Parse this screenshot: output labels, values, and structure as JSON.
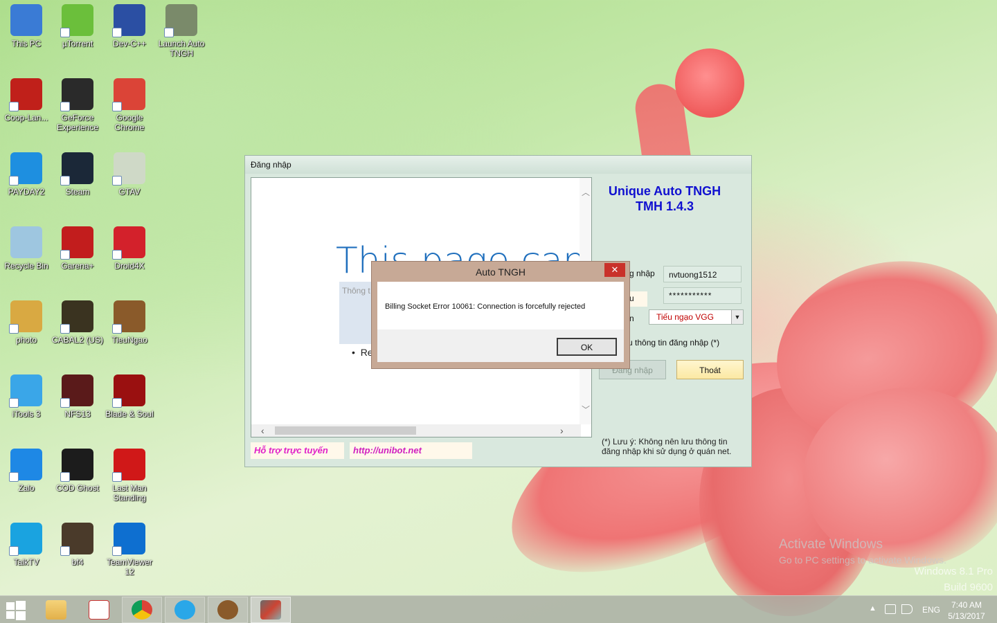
{
  "desktop": {
    "icons": [
      {
        "label": "This PC",
        "icon": "computer-icon"
      },
      {
        "label": "µTorrent",
        "icon": "utorrent-icon"
      },
      {
        "label": "Dev-C++",
        "icon": "devcpp-icon"
      },
      {
        "label": "Launch Auto TNGH",
        "icon": "launch-auto-icon"
      },
      {
        "label": "Coop-Lan...",
        "icon": "cooplan-icon"
      },
      {
        "label": "GeForce Experience",
        "icon": "geforce-icon"
      },
      {
        "label": "Google Chrome",
        "icon": "chrome-icon"
      },
      {
        "label": "PAYDAY2",
        "icon": "payday-icon"
      },
      {
        "label": "Steam",
        "icon": "steam-icon"
      },
      {
        "label": "GTAV",
        "icon": "gtav-icon"
      },
      {
        "label": "Recycle Bin",
        "icon": "recycle-bin-icon"
      },
      {
        "label": "Garena+",
        "icon": "garena-icon"
      },
      {
        "label": "Droid4X",
        "icon": "droid4x-icon"
      },
      {
        "label": "photo",
        "icon": "folder-icon"
      },
      {
        "label": "CABAL2 (US)",
        "icon": "cabal-icon"
      },
      {
        "label": "TieuNgao",
        "icon": "tieungao-icon"
      },
      {
        "label": "iTools 3",
        "icon": "itools-icon"
      },
      {
        "label": "NFS13",
        "icon": "nfs-icon"
      },
      {
        "label": "Blade & Soul",
        "icon": "blade-soul-icon"
      },
      {
        "label": "Zalo",
        "icon": "zalo-icon"
      },
      {
        "label": "COD Ghost",
        "icon": "cod-icon"
      },
      {
        "label": "Last Man Standing",
        "icon": "lastman-icon"
      },
      {
        "label": "TalkTV",
        "icon": "talktv-icon"
      },
      {
        "label": "bf4",
        "icon": "bf4-icon"
      },
      {
        "label": "TeamViewer 12",
        "icon": "teamviewer-icon"
      }
    ]
  },
  "login_window": {
    "title": "Đăng nhập",
    "browser": {
      "heading": "This page can’t be",
      "info_label": "Thông t",
      "bullet": "Re"
    },
    "support_link": "Hỗ trợ trực tuyến",
    "site_link": "http://unibot.net",
    "app_title_line1": "Unique Auto TNGH",
    "app_title_line2": "TMH 1.4.3",
    "username_label": "g nhập",
    "password_label": "u",
    "server_label": "n",
    "username_value": "nvtuong1512",
    "password_value": "***********",
    "server_value": "Tiếu ngạo VGG",
    "remember_label": "u thông tin đăng nhập (*)",
    "login_button": "Đăng nhập",
    "exit_button": "Thoát",
    "note": "(*) Lưu ý:  Không nên lưu thông tin đăng nhập khi sử dụng ở quán net."
  },
  "error_dialog": {
    "title": "Auto TNGH",
    "close": "✕",
    "message": "Billing Socket Error 10061: Connection is forcefully rejected",
    "ok_button": "OK"
  },
  "watermark": {
    "line1": "Activate Windows",
    "line2": "Go to PC settings to activate Windows.",
    "line3": "Windows 8.1 Pro",
    "line4": "Build 9600"
  },
  "taskbar": {
    "tray_up": "▲",
    "language": "ENG",
    "time": "7:40 AM",
    "date": "5/13/2017"
  },
  "colors": {
    "app_title": "#1010d0",
    "link": "#e020c8",
    "server_value": "#c00000",
    "close_button": "#c9312a"
  }
}
